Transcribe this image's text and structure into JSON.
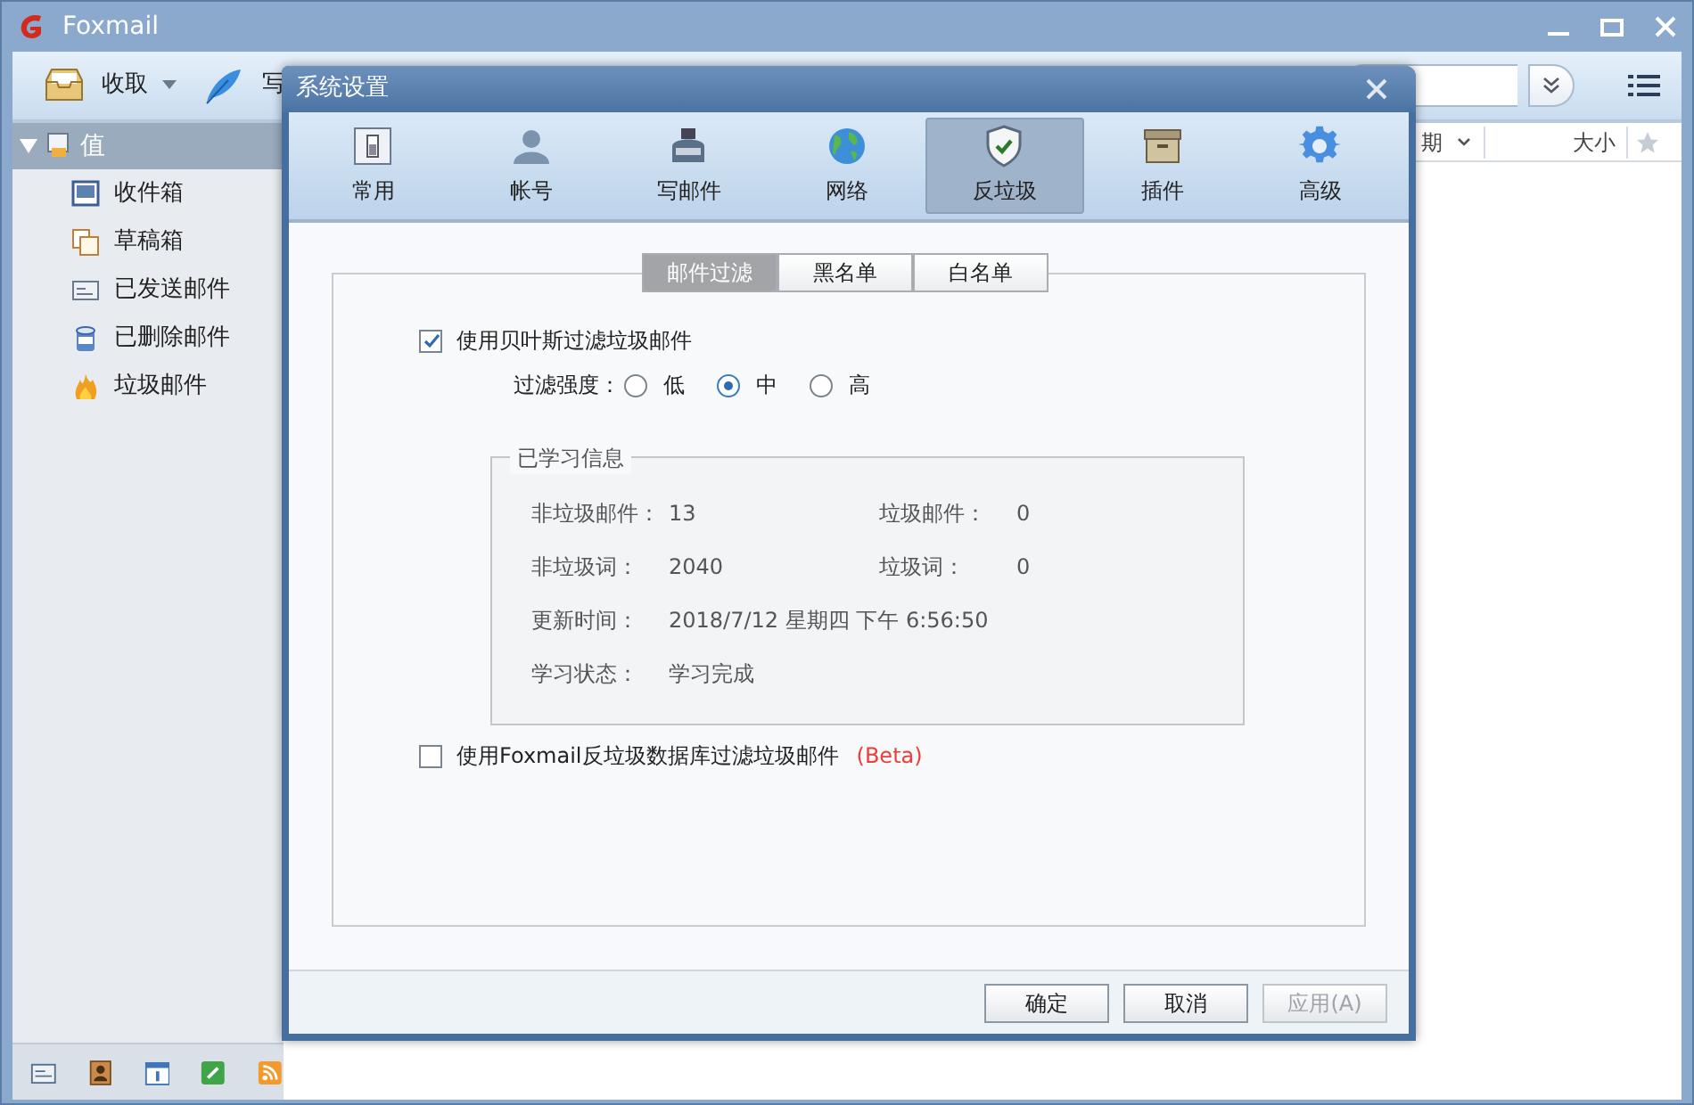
{
  "main_window": {
    "title": "Foxmail",
    "toolbar": [
      {
        "label": "收取",
        "kind": "receive"
      },
      {
        "label": "写",
        "kind": "compose"
      }
    ],
    "columns": [
      {
        "label": "期",
        "kind": "sort"
      },
      {
        "label": "大小",
        "kind": "plain"
      }
    ],
    "account": {
      "label": "值",
      "expanded": true,
      "children": [
        {
          "label": "收件箱",
          "kind": "inbox"
        },
        {
          "label": "草稿箱",
          "kind": "drafts"
        },
        {
          "label": "已发送邮件",
          "kind": "sent"
        },
        {
          "label": "已删除邮件",
          "kind": "deleted"
        },
        {
          "label": "垃圾邮件",
          "kind": "junk"
        }
      ]
    }
  },
  "dialog": {
    "title": "系统设置",
    "tabs": [
      {
        "label": "常用",
        "kind": "general",
        "selected": false
      },
      {
        "label": "帐号",
        "kind": "account",
        "selected": false
      },
      {
        "label": "写邮件",
        "kind": "compose",
        "selected": false
      },
      {
        "label": "网络",
        "kind": "network",
        "selected": false
      },
      {
        "label": "反垃圾",
        "kind": "antispam",
        "selected": true
      },
      {
        "label": "插件",
        "kind": "plugin",
        "selected": false
      },
      {
        "label": "高级",
        "kind": "advanced",
        "selected": false
      }
    ],
    "subtabs": [
      {
        "label": "邮件过滤",
        "selected": true
      },
      {
        "label": "黑名单",
        "selected": false
      },
      {
        "label": "白名单",
        "selected": false
      }
    ],
    "bayes": {
      "label": "使用贝叶斯过滤垃圾邮件",
      "checked": true
    },
    "strength": {
      "label": "过滤强度：",
      "options": [
        {
          "label": "低",
          "selected": false
        },
        {
          "label": "中",
          "selected": true
        },
        {
          "label": "高",
          "selected": false
        }
      ]
    },
    "learned": {
      "title": "已学习信息",
      "rows": [
        [
          {
            "label": "非垃圾邮件：",
            "value": "13"
          },
          {
            "label": "垃圾邮件：",
            "value": "0"
          }
        ],
        [
          {
            "label": "非垃圾词：",
            "value": "2040"
          },
          {
            "label": "垃圾词：",
            "value": "0"
          }
        ],
        [
          {
            "label": "更新时间：",
            "value": "2018/7/12 星期四 下午 6:56:50"
          }
        ],
        [
          {
            "label": "学习状态：",
            "value": "学习完成"
          }
        ]
      ]
    },
    "database": {
      "label": "使用Foxmail反垃圾数据库过滤垃圾邮件",
      "tag": "(Beta)",
      "checked": false
    },
    "buttons": [
      {
        "label": "确定",
        "disabled": false
      },
      {
        "label": "取消",
        "disabled": false
      },
      {
        "label": "应用(A)",
        "disabled": true
      }
    ]
  }
}
